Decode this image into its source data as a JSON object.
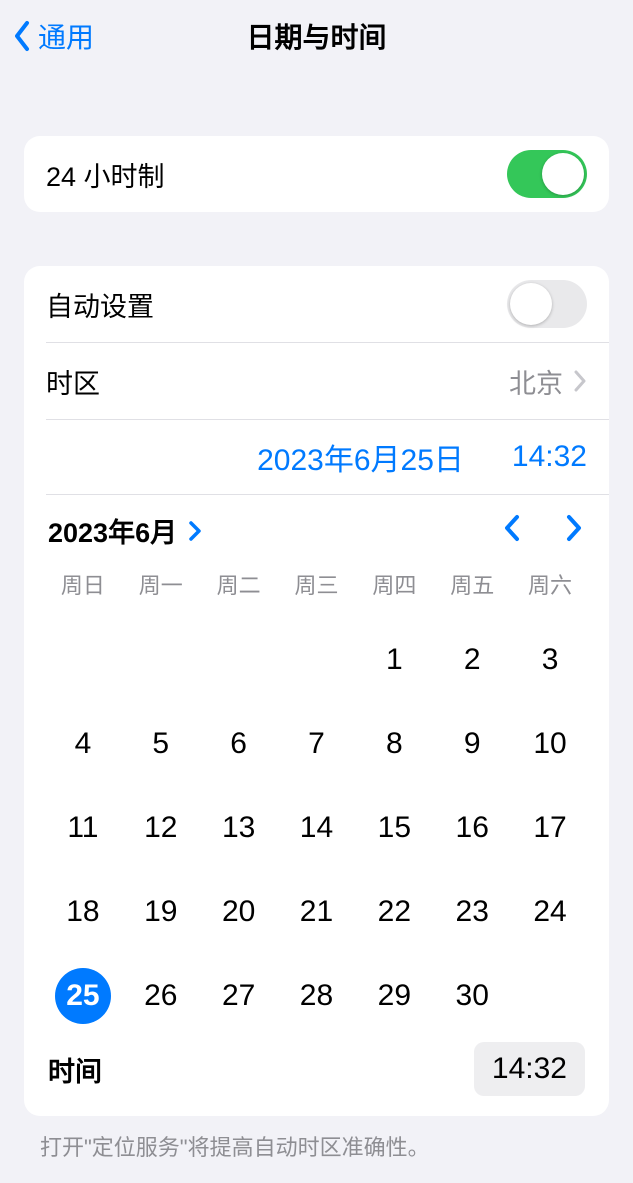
{
  "nav": {
    "back": "通用",
    "title": "日期与时间"
  },
  "hour24": {
    "label": "24 小时制",
    "on": true
  },
  "autoset": {
    "label": "自动设置",
    "on": false
  },
  "tz": {
    "label": "时区",
    "value": "北京"
  },
  "dt": {
    "date": "2023年6月25日",
    "time": "14:32"
  },
  "cal": {
    "month": "2023年6月",
    "weekdays": [
      "周日",
      "周一",
      "周二",
      "周三",
      "周四",
      "周五",
      "周六"
    ],
    "firstDow": 4,
    "numDays": 30,
    "selected": 25
  },
  "timeRow": {
    "label": "时间",
    "value": "14:32"
  },
  "footer": "打开\"定位服务\"将提高自动时区准确性。"
}
